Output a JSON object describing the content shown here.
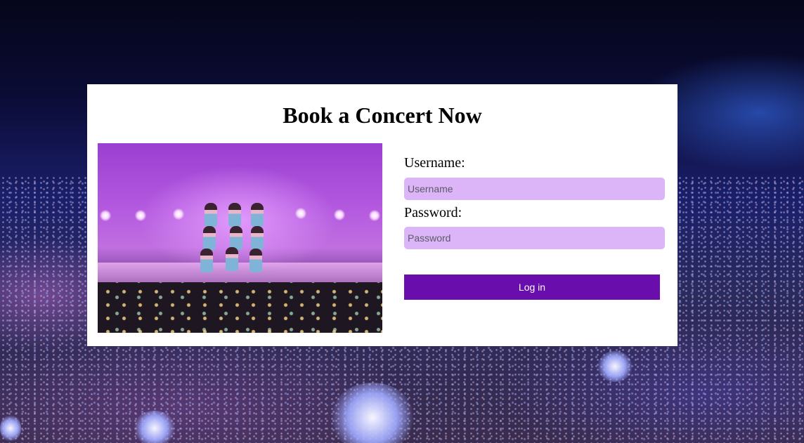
{
  "page": {
    "title": "Book a Concert Now"
  },
  "form": {
    "username_label": "Username:",
    "username_placeholder": "Username",
    "username_value": "",
    "password_label": "Password:",
    "password_placeholder": "Password",
    "password_value": "",
    "login_label": "Log in"
  },
  "colors": {
    "accent": "#6a0dad",
    "input_bg": "#dcb4f8",
    "card_bg": "#ffffff"
  }
}
